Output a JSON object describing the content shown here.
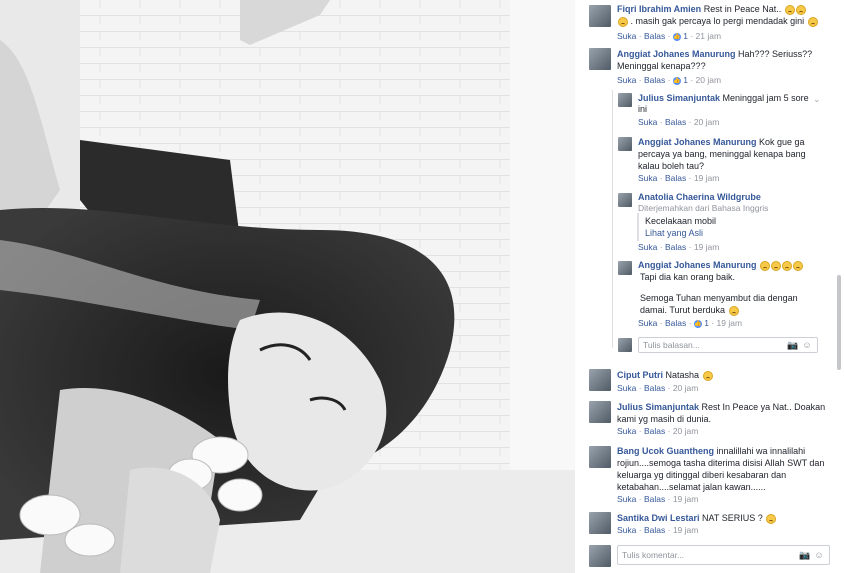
{
  "comments": [
    {
      "author": "Fiqri Ibrahim Amien",
      "text_a": "Rest in Peace Nat..",
      "text_b": ". masih gak percaya lo pergi mendadak gini",
      "like": "Suka",
      "reply": "Balas",
      "reactions": "1",
      "time": "21 jam"
    },
    {
      "author": "Anggiat Johanes Manurung",
      "text_a": "Hah??? Seriuss??",
      "text_b": "Meninggal kenapa???",
      "like": "Suka",
      "reply": "Balas",
      "reactions": "1",
      "time": "20 jam"
    }
  ],
  "replies": [
    {
      "author": "Julius Simanjuntak",
      "text_a": "Meninggal jam 5 sore",
      "text_b": "ini",
      "like": "Suka",
      "reply": "Balas",
      "time": "20 jam"
    },
    {
      "author": "Anggiat Johanes Manurung",
      "text_a": "Kok gue ga",
      "text_b": "percaya ya bang, meninggal kenapa bang",
      "text_c": "kalau boleh tau?",
      "like": "Suka",
      "reply": "Balas",
      "time": "19 jam"
    },
    {
      "author": "Anatolia Chaerina Wildgrube",
      "translated": "Diterjemahkan dari Bahasa Inggris",
      "text_a": "Kecelakaan mobil",
      "see_original": "Lihat yang Asli",
      "like": "Suka",
      "reply": "Balas",
      "time": "19 jam"
    },
    {
      "author": "Anggiat Johanes Manurung",
      "text_a": "Tapi dia kan orang baik.",
      "text_b": "Semoga Tuhan menyambut dia dengan",
      "text_c": "damai. Turut berduka",
      "like": "Suka",
      "reply": "Balas",
      "reactions": "1",
      "time": "19 jam"
    }
  ],
  "reply_input": {
    "placeholder": "Tulis balasan..."
  },
  "comments2": [
    {
      "author": "Ciput Putri",
      "text_a": "Natasha",
      "like": "Suka",
      "reply": "Balas",
      "time": "20 jam"
    },
    {
      "author": "Julius Simanjuntak",
      "text_a": "Rest In Peace ya Nat.. Doakan",
      "text_b": "kami yg masih di dunia.",
      "like": "Suka",
      "reply": "Balas",
      "time": "20 jam"
    },
    {
      "author": "Bang Ucok Guantheng",
      "text_a": "innalillahi wa innalilahi",
      "text_b": "rojiun....semoga tasha diterima disisi Allah SWT dan",
      "text_c": "keluarga yg ditinggal diberi kesabaran dan",
      "text_d": "ketabahan....selamat jalan kawan......",
      "like": "Suka",
      "reply": "Balas",
      "time": "19 jam"
    },
    {
      "author": "Santika Dwi Lestari",
      "text_a": "NAT SERIUS ?",
      "like": "Suka",
      "reply": "Balas",
      "time": "19 jam"
    }
  ],
  "comment_input": {
    "placeholder": "Tulis komentar..."
  },
  "icons": {
    "camera": "camera-icon",
    "emoji": "emoji-icon",
    "like": "like-icon",
    "chevron": "chevron-down-icon"
  },
  "colors": {
    "link": "#365899",
    "meta": "#90949c",
    "like_badge": "#5890ff"
  }
}
